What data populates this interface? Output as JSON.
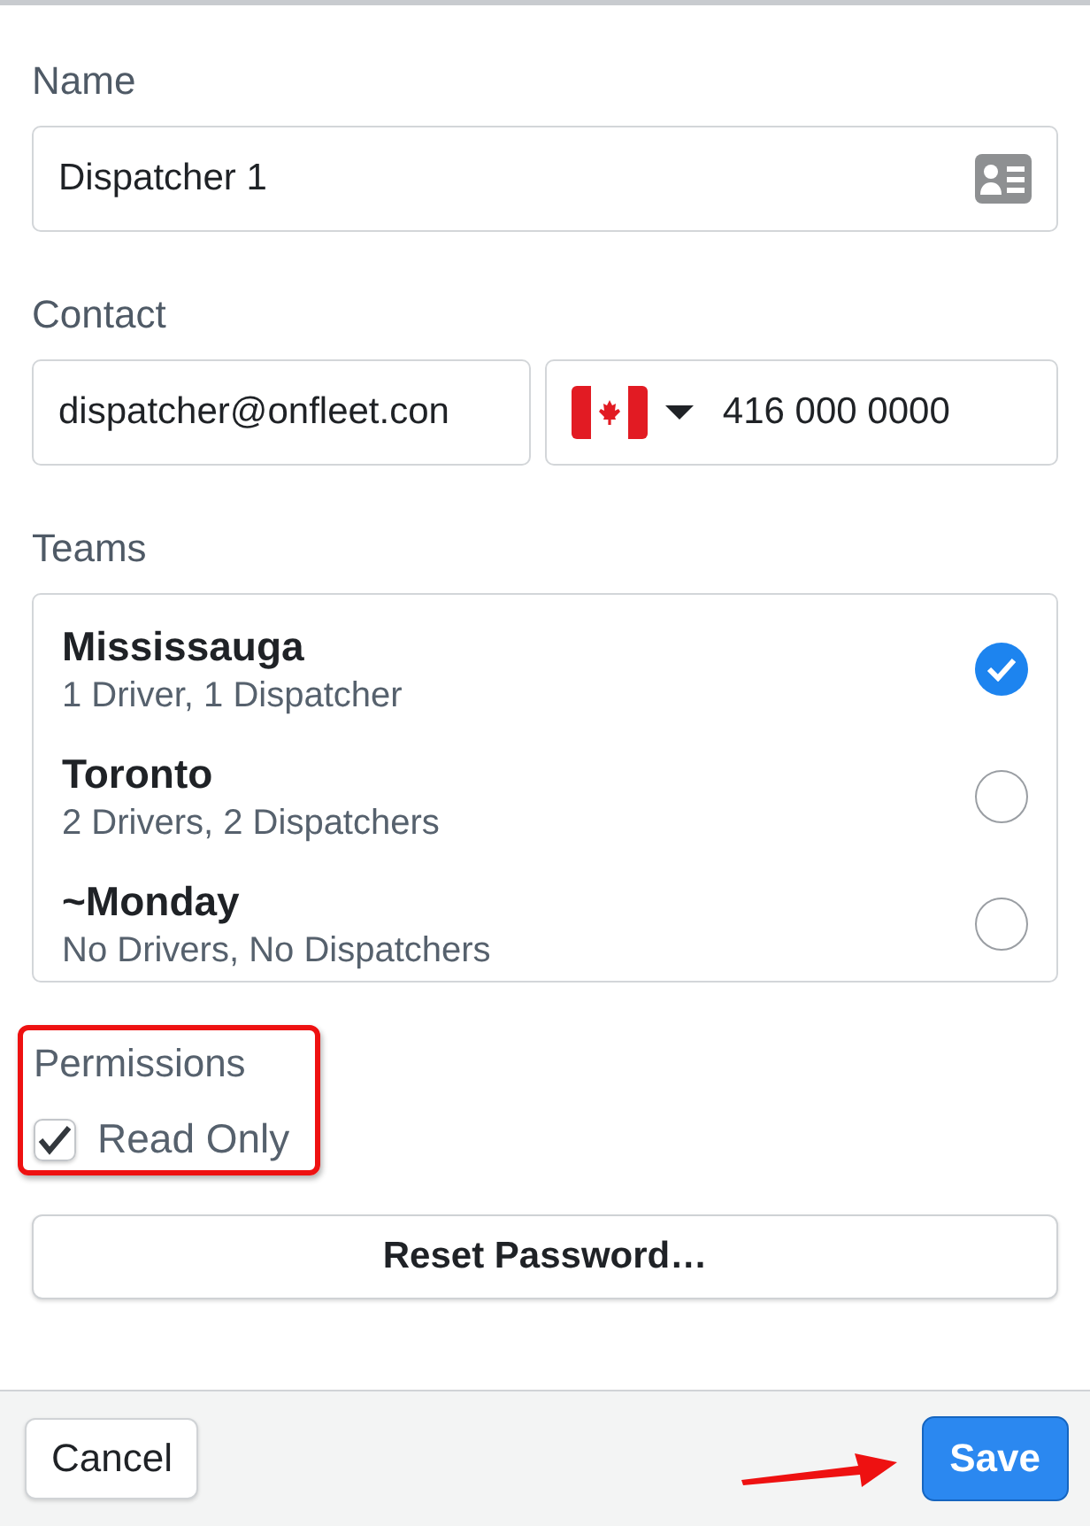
{
  "name": {
    "label": "Name",
    "value": "Dispatcher 1"
  },
  "contact": {
    "label": "Contact",
    "email": "dispatcher@onfleet.con",
    "phone": "416 000 0000"
  },
  "teams": {
    "label": "Teams",
    "items": [
      {
        "name": "Mississauga",
        "detail": "1 Driver, 1 Dispatcher",
        "selected": true
      },
      {
        "name": "Toronto",
        "detail": "2 Drivers, 2 Dispatchers",
        "selected": false
      },
      {
        "name": "~Monday",
        "detail": "No Drivers, No Dispatchers",
        "selected": false
      }
    ]
  },
  "permissions": {
    "label": "Permissions",
    "option": "Read Only",
    "checked": true
  },
  "reset_button": "Reset Password…",
  "footer": {
    "cancel": "Cancel",
    "save": "Save"
  }
}
